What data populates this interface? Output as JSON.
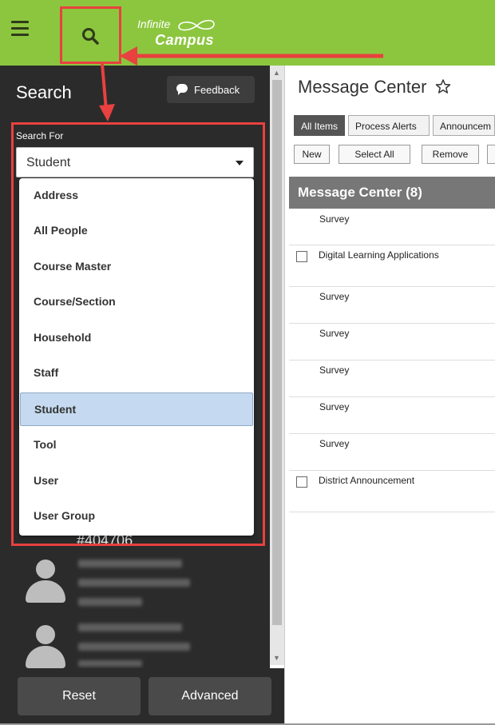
{
  "app": {
    "logo_line1": "Infinite",
    "logo_line2": "Campus",
    "brand_color": "#8cc63f",
    "highlight_color": "#e8413f"
  },
  "sidebar": {
    "title": "Search",
    "feedback_label": "Feedback",
    "search_for_label": "Search For",
    "selected_value": "Student",
    "options": [
      "Address",
      "All People",
      "Course Master",
      "Course/Section",
      "Household",
      "Staff",
      "Student",
      "Tool",
      "User",
      "User Group"
    ],
    "behind_text": "#404706",
    "reset_label": "Reset",
    "advanced_label": "Advanced"
  },
  "main": {
    "title": "Message Center",
    "tabs": [
      "All Items",
      "Process Alerts",
      "Announcem"
    ],
    "toolbar": [
      "New",
      "Select All",
      "Remove"
    ],
    "header": "Message Center (8)",
    "rows": [
      {
        "text": "Survey",
        "checkbox": false
      },
      {
        "text": "Digital Learning Applications",
        "checkbox": true
      },
      {
        "text": "Survey",
        "checkbox": false
      },
      {
        "text": "Survey",
        "checkbox": false
      },
      {
        "text": "Survey",
        "checkbox": false
      },
      {
        "text": "Survey",
        "checkbox": false
      },
      {
        "text": "Survey",
        "checkbox": false
      },
      {
        "text": "District Announcement",
        "checkbox": true
      }
    ]
  }
}
